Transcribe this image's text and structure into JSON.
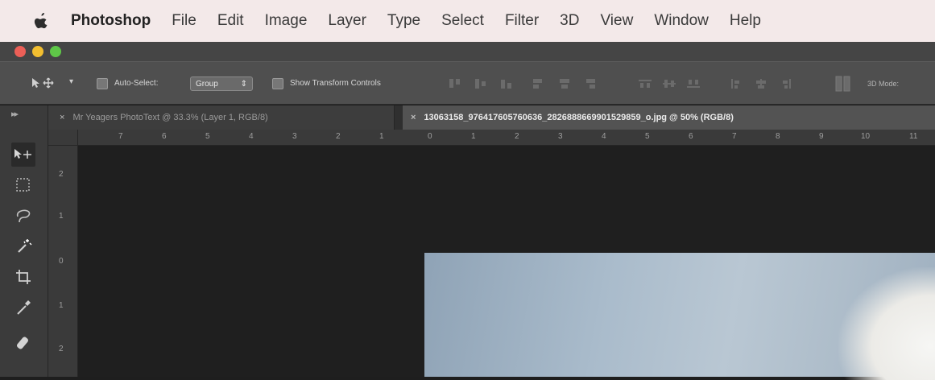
{
  "menubar": {
    "app_name": "Photoshop",
    "items": [
      "File",
      "Edit",
      "Image",
      "Layer",
      "Type",
      "Select",
      "Filter",
      "3D",
      "View",
      "Window",
      "Help"
    ]
  },
  "options": {
    "auto_select_label": "Auto-Select:",
    "auto_select_value": "Group",
    "show_transform_label": "Show Transform Controls",
    "mode_3d_label": "3D Mode:"
  },
  "tabs": [
    {
      "label": "Mr Yeagers PhotoText @ 33.3% (Layer 1, RGB/8)",
      "active": false
    },
    {
      "label": "13063158_976417605760636_2826888669901529859_o.jpg @ 50% (RGB/8)",
      "active": true
    }
  ],
  "rulers": {
    "horizontal": [
      "7",
      "6",
      "5",
      "4",
      "3",
      "2",
      "1",
      "0",
      "1",
      "2",
      "3",
      "4",
      "5",
      "6",
      "7",
      "8",
      "9",
      "10",
      "11"
    ],
    "vertical": [
      "2",
      "1",
      "0",
      "1",
      "2"
    ]
  },
  "tools": [
    "move-tool",
    "marquee-tool",
    "lasso-tool",
    "magic-wand-tool",
    "crop-tool",
    "eyedropper-tool",
    "healing-brush-tool"
  ],
  "colors": {
    "menubar_bg": "#f3e9e9",
    "ui_dark": "#3b3b3b",
    "canvas_bg": "#1f1f1f"
  }
}
